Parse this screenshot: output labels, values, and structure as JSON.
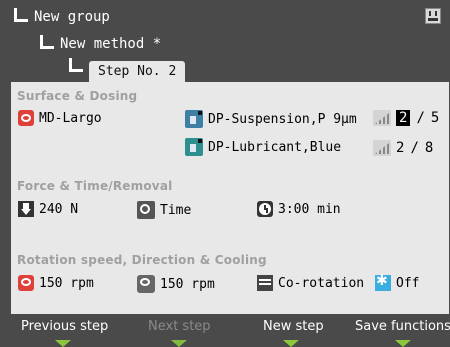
{
  "header": {
    "group": "New group",
    "method": "New method *",
    "step_tab": "Step No. 2"
  },
  "icons": {
    "top_right": "save-to-card-icon"
  },
  "sections": {
    "surface": {
      "title": "Surface & Dosing",
      "surface_label": "MD-Largo",
      "suspension_label": "DP-Suspension,P 9µm",
      "lubricant_label": "DP-Lubricant,Blue",
      "suspension_level": "2",
      "suspension_max": "5",
      "lubricant_level": "2",
      "lubricant_max": "8",
      "separator": "/"
    },
    "force": {
      "title": "Force & Time/Removal",
      "force_value": "240 N",
      "mode_label": "Time",
      "time_value": "3:00 min"
    },
    "rotation": {
      "title": "Rotation speed, Direction & Cooling",
      "disc_speed": "150 rpm",
      "head_speed": "150 rpm",
      "direction": "Co-rotation",
      "cooling": "Off"
    }
  },
  "footer": {
    "previous": "Previous step",
    "next": "Next step",
    "new": "New step",
    "save": "Save functions"
  },
  "colors": {
    "background": "#4a4a4a",
    "panel": "#e8e8e8",
    "section_title": "#a0a0a0",
    "accent_red": "#e0403a",
    "softkey_indicator": "#8cc63f",
    "disabled_text": "#8a8a8a"
  }
}
